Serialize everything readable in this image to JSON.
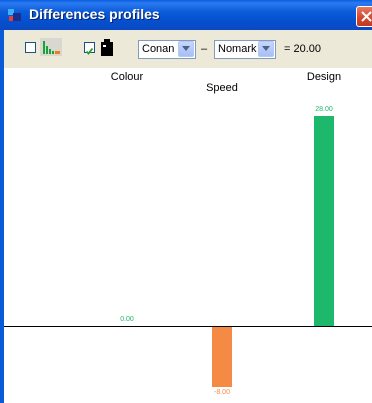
{
  "window": {
    "title": "Differences profiles"
  },
  "toolbar": {
    "checkbox1_checked": false,
    "checkbox2_checked": true,
    "product_a": "Conan",
    "dash": "–",
    "product_b": "Nomark",
    "equals_text": "= 20.00"
  },
  "chart_data": {
    "type": "bar",
    "categories": [
      "Colour",
      "Speed",
      "Design"
    ],
    "values": [
      0.0,
      -8.0,
      28.0
    ],
    "value_labels": [
      "0.00",
      "-8.00",
      "28.00"
    ],
    "colors": {
      "positive": "#1db86b",
      "negative": "#f58a45",
      "baseline": "#000000"
    },
    "ylim": [
      -8,
      28
    ]
  }
}
